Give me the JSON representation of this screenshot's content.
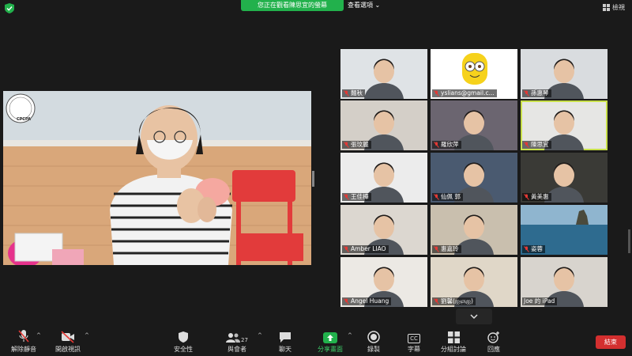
{
  "topbar": {
    "sharing_label": "您正在觀看陳思宜的螢幕",
    "view_options_label": "查看選項",
    "view_options_chevron": "⌄",
    "view_button_label": "檢視"
  },
  "main_video": {
    "logo_text": "CPCPA"
  },
  "participants": [
    {
      "name": "麵秋",
      "muted": true
    },
    {
      "name": "yslians@gmail.c...",
      "muted": true
    },
    {
      "name": "孫惠琴",
      "muted": true
    },
    {
      "name": "張玟麗",
      "muted": true
    },
    {
      "name": "羅欣萍",
      "muted": true
    },
    {
      "name": "陳思宜",
      "muted": true,
      "active": true
    },
    {
      "name": "王佳樺",
      "muted": true
    },
    {
      "name": "仙佩 郭",
      "muted": true
    },
    {
      "name": "黃美惠",
      "muted": true
    },
    {
      "name": "Amber LIAO",
      "muted": true
    },
    {
      "name": "惠嘉玲",
      "muted": true
    },
    {
      "name": "姿蓉",
      "muted": true
    },
    {
      "name": "Angel Huang",
      "muted": true
    },
    {
      "name": "劉馨(ஐஞஐ)",
      "muted": true
    },
    {
      "name": "Joe 的 iPad",
      "muted": false
    }
  ],
  "toolbar": {
    "unmute_label": "解除靜音",
    "start_video_label": "開啟視訊",
    "security_label": "安全性",
    "participants_label": "與會者",
    "participants_count": "27",
    "chat_label": "聊天",
    "share_label": "分享畫面",
    "record_label": "錄製",
    "cc_icon_text": "CC",
    "captions_label": "字幕",
    "breakout_label": "分組討論",
    "reactions_label": "回應",
    "end_label": "結束",
    "caret": "^"
  },
  "colors": {
    "share_green": "#22b14c",
    "active_border": "#c8e04a",
    "end_red": "#d32f2f",
    "background": "#1a1a1a"
  }
}
